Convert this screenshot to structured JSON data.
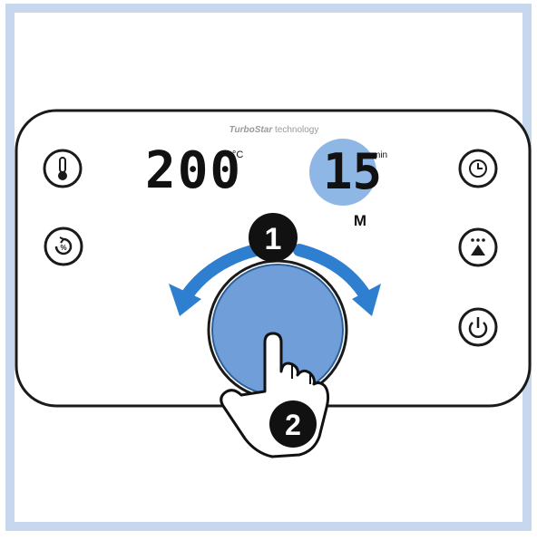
{
  "brand": {
    "name_bold": "TurboStar",
    "name_light": " technology"
  },
  "display": {
    "temperature_value": "200",
    "temperature_unit": "°C",
    "time_value": "15",
    "time_unit": "min",
    "mode_letter": "M"
  },
  "steps": {
    "rotate_step": "1",
    "press_step": "2"
  },
  "icons": {
    "left": [
      "thermometer-icon",
      "preheat-fan-icon"
    ],
    "right": [
      "timer-clock-icon",
      "shake-reminder-icon",
      "power-icon"
    ]
  },
  "colors": {
    "accent_blue": "#2f7fd0",
    "highlight_blue": "#7aaae0",
    "knob_fill": "#6f9ed9",
    "frame": "#c7d7ee",
    "ink": "#1a1a1a"
  }
}
